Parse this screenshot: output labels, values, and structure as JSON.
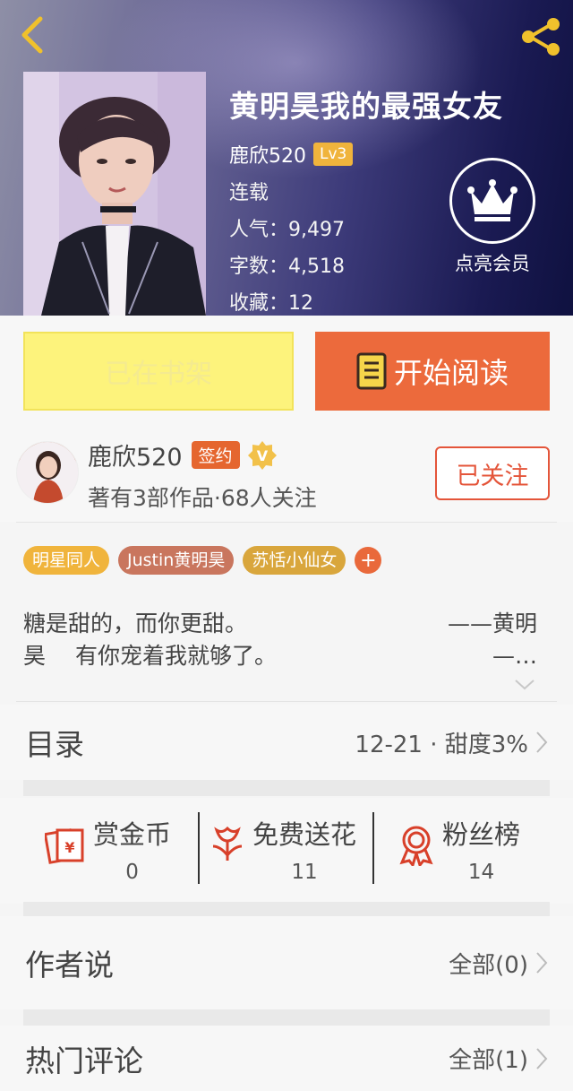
{
  "header": {
    "book_title": "黄明昊我的最强女友",
    "author": "鹿欣520",
    "level": "Lv3",
    "status": "连载",
    "popularity": "人气：9,497",
    "word_count": "字数：4,518",
    "favorites": "收藏：12",
    "vip_label": "点亮会员"
  },
  "actions": {
    "shelf_label": "已在书架",
    "read_label": "开始阅读"
  },
  "author_card": {
    "name": "鹿欣520",
    "badge": "签约",
    "meta": "著有3部作品·68人关注",
    "follow_label": "已关注"
  },
  "tags": [
    {
      "label": "明星同人",
      "color": "#f0b43c"
    },
    {
      "label": "Justin黄明昊",
      "color": "#c9765e"
    },
    {
      "label": "苏恬小仙女",
      "color": "#d9a63c"
    }
  ],
  "tag_add": "+",
  "description": {
    "line1_left": "糖是甜的，而你更甜。",
    "line1_right": "——黄明",
    "line2_left": "昊　 有你宠着我就够了。",
    "line2_right": "—…"
  },
  "catalog": {
    "label": "目录",
    "value": "12-21 · 甜度3%"
  },
  "stats": [
    {
      "title": "赏金币",
      "count": "0",
      "icon": "red-envelope-icon"
    },
    {
      "title": "免费送花",
      "count": "11",
      "icon": "flower-icon"
    },
    {
      "title": "粉丝榜",
      "count": "14",
      "icon": "medal-icon"
    }
  ],
  "author_says": {
    "label": "作者说",
    "value": "全部(0)"
  },
  "hot_comments": {
    "label": "热门评论",
    "value": "全部(1)"
  },
  "colors": {
    "accent": "#ec6a3c",
    "shelf_yellow": "#fdf37c",
    "follow_red": "#e4553a",
    "gold": "#f0b43c"
  }
}
